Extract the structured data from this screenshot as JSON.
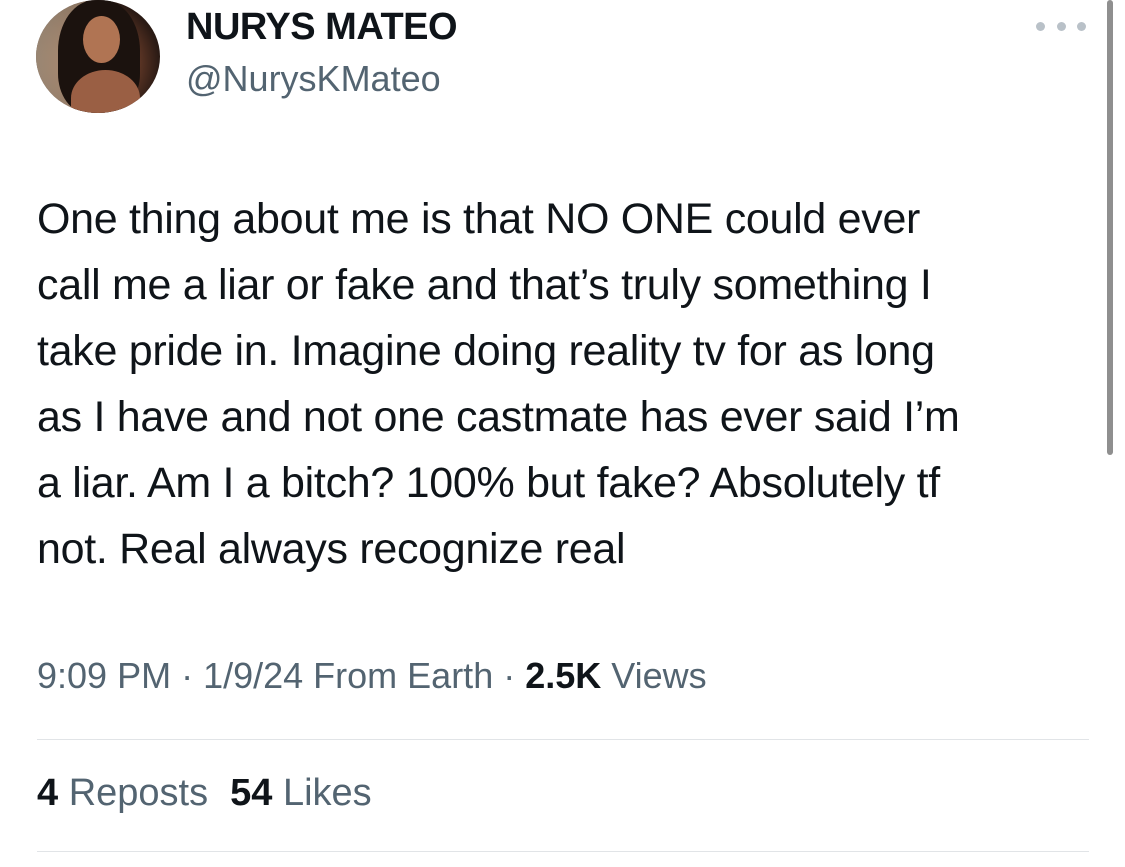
{
  "author": {
    "display_name": "NURYS MATEO",
    "handle": "@NurysKMateo",
    "avatar_icon": "profile-photo-icon"
  },
  "tweet": {
    "lines": [
      "One thing about me is that NO ONE could ever",
      "call me a liar or fake and that’s truly something I",
      "take pride in. Imagine doing reality tv for as long",
      "as I have and not one castmate has ever said I’m",
      "a liar. Am I a bitch? 100% but fake? Absolutely tf",
      "not. Real always recognize real"
    ]
  },
  "meta": {
    "time": "9:09 PM",
    "sep1": " · ",
    "date": "1/9/24",
    "source": " From Earth",
    "sep2": " · ",
    "views_count": "2.5K",
    "views_label": " Views"
  },
  "stats": {
    "reposts_count": "4",
    "reposts_label": " Reposts",
    "likes_count": "54",
    "likes_label": " Likes"
  },
  "icons": {
    "more": "more-options-icon"
  },
  "colors": {
    "primary_text": "#0f1419",
    "secondary_text": "#536471",
    "divider": "#e1e4e7"
  }
}
